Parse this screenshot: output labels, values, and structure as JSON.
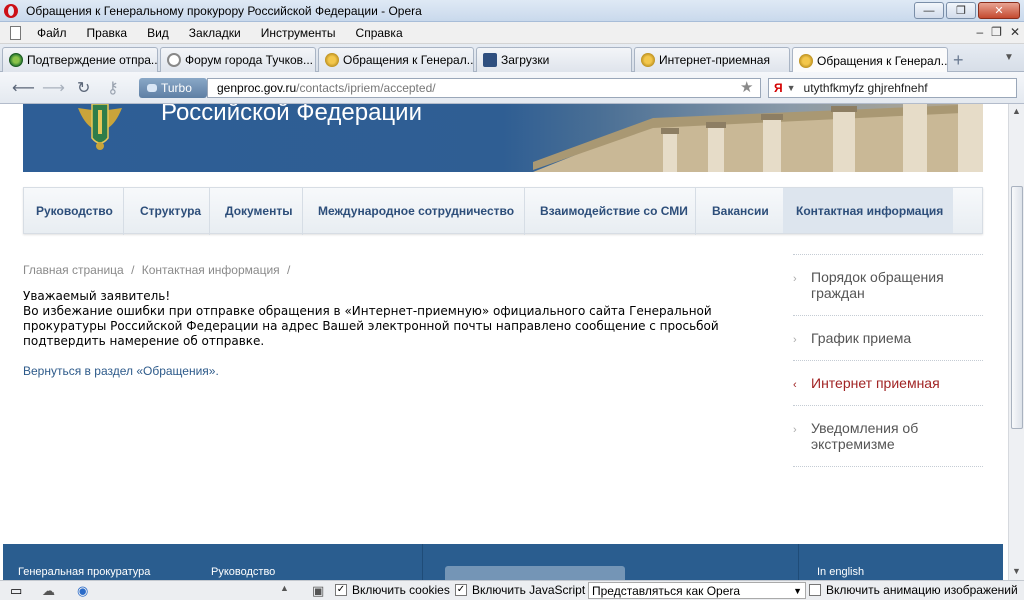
{
  "window": {
    "title": "Обращения к Генеральному прокурору Российской Федерации - Opera",
    "minimize": "—",
    "maximize": "❐",
    "close": "✕"
  },
  "menu": [
    "Файл",
    "Правка",
    "Вид",
    "Закладки",
    "Инструменты",
    "Справка"
  ],
  "menu_controls": [
    "–",
    "❐",
    "✕"
  ],
  "tabs": [
    {
      "label": "Подтверждение отпра...",
      "icon": "green-globe-icon"
    },
    {
      "label": "Форум города Тучков...",
      "icon": "loading-ring-icon"
    },
    {
      "label": "Обращения к Генерал...",
      "icon": "eagle-emblem-icon"
    },
    {
      "label": "Загрузки",
      "icon": "downloads-icon"
    },
    {
      "label": "Интернет-приемная",
      "icon": "eagle-emblem-icon"
    },
    {
      "label": "Обращения к Генерал...",
      "icon": "eagle-emblem-icon",
      "active": true
    }
  ],
  "toolbar": {
    "turbo": "Turbo",
    "url_host": "genproc.gov.ru",
    "url_path": "/contacts/ipriem/accepted/",
    "search_engine": "Я",
    "search_value": "utythfkmyfz ghjrehfnehf"
  },
  "site": {
    "banner_title": "Российской Федерации",
    "nav": [
      "Руководство",
      "Структура",
      "Документы",
      "Международное сотрудничество",
      "Взаимодействие со СМИ",
      "Вакансии",
      "Контактная информация"
    ],
    "breadcrumb": {
      "home": "Главная страница",
      "sep": "/",
      "current": "Контактная информация"
    },
    "notice": {
      "greeting": "Уважаемый заявитель!",
      "body": "Во избежание ошибки при отправке обращения в «Интернет-приемную» официального сайта Генеральной прокуратуры Российской Федерации на адрес Вашей электронной почты направлено сообщение с просьбой подтвердить намерение об отправке."
    },
    "back_link": "Вернуться в раздел «Обращения».",
    "sidebar": [
      {
        "label": "Порядок обращения граждан",
        "active": false
      },
      {
        "label": "График приема",
        "active": false
      },
      {
        "label": "Интернет приемная",
        "active": true
      },
      {
        "label": "Уведомления об экстремизме",
        "active": false
      }
    ],
    "footer": {
      "col1": "Генеральная прокуратура",
      "col2": "Руководство",
      "english": "In english"
    }
  },
  "statusbar": {
    "cookies": "Включить cookies",
    "javascript": "Включить JavaScript",
    "identify_as": "Представляться как Opera",
    "images_anim": "Включить анимацию изображений"
  },
  "colors": {
    "banner_blue": "#2e5e96",
    "nav_link": "#2d4e7a",
    "sidebar_active": "#a12424",
    "footer_blue": "#2a5d8f"
  }
}
